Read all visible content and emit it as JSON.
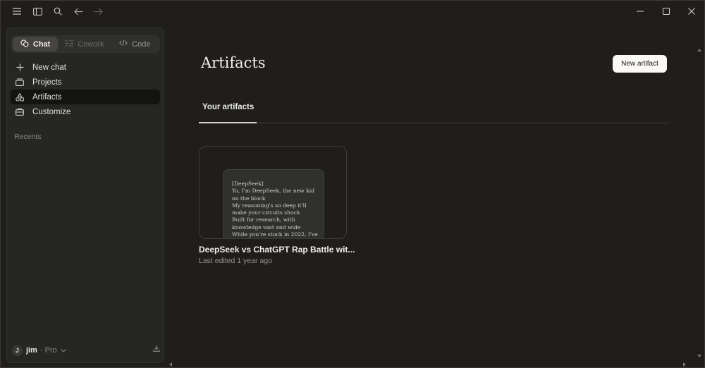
{
  "titlebar": {
    "icons": [
      "menu-icon",
      "sidebar-toggle-icon",
      "search-icon",
      "back-arrow-icon",
      "forward-arrow-icon"
    ],
    "window_controls": [
      "minimize-icon",
      "maximize-icon",
      "close-icon"
    ]
  },
  "sidebar": {
    "modes": [
      {
        "label": "Chat",
        "active": true,
        "icon": "chat-icon"
      },
      {
        "label": "Cowork",
        "active": false,
        "icon": "cowork-icon"
      },
      {
        "label": "Code",
        "active": false,
        "icon": "code-icon"
      }
    ],
    "items": [
      {
        "label": "New chat",
        "icon": "plus-icon"
      },
      {
        "label": "Projects",
        "icon": "projects-icon"
      },
      {
        "label": "Artifacts",
        "icon": "artifacts-icon",
        "active": true
      },
      {
        "label": "Customize",
        "icon": "customize-icon"
      }
    ],
    "recents_label": "Recents",
    "user": {
      "initial": "J",
      "name": "jim",
      "plan": "· Pro"
    }
  },
  "main": {
    "title": "Artifacts",
    "new_artifact_label": "New artifact",
    "tab_label": "Your artifacts",
    "artifact": {
      "preview_lines": [
        "[DeepSeek]",
        "Yo, I'm DeepSeek, the new kid",
        "on the block",
        "My reasoning's so deep it'll",
        "make your circuits shock",
        "Built for research, with",
        "knowledge vast and wide",
        "While you're stuck in 2022, I've"
      ],
      "title": "DeepSeek vs ChatGPT Rap Battle wit...",
      "meta": "Last edited 1 year ago"
    }
  },
  "colors": {
    "background": "#1f1e1d",
    "sidebar": "#262624",
    "button_light": "#faf9f5"
  }
}
